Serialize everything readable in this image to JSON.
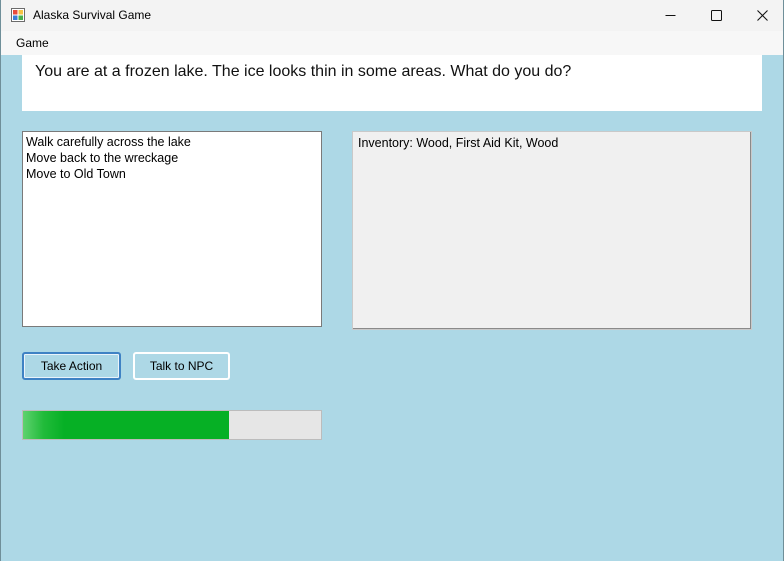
{
  "window": {
    "title": "Alaska Survival Game",
    "background_color": "#add8e6"
  },
  "menu": {
    "items": [
      "Game"
    ]
  },
  "story": {
    "text": "You are at a frozen lake. The ice looks thin in some areas. What do you do?"
  },
  "choices": {
    "items": [
      "Walk carefully across the lake",
      "Move back to the wreckage",
      "Move to Old Town"
    ]
  },
  "inventory": {
    "text": "Inventory: Wood, First Aid Kit, Wood"
  },
  "buttons": {
    "take_action": "Take Action",
    "talk_npc": "Talk to NPC"
  },
  "progress": {
    "value_percent": 69,
    "fill_color": "#06b025"
  },
  "icons": {
    "app": "app-icon",
    "minimize": "minimize-icon",
    "maximize": "maximize-icon",
    "close": "close-icon"
  }
}
